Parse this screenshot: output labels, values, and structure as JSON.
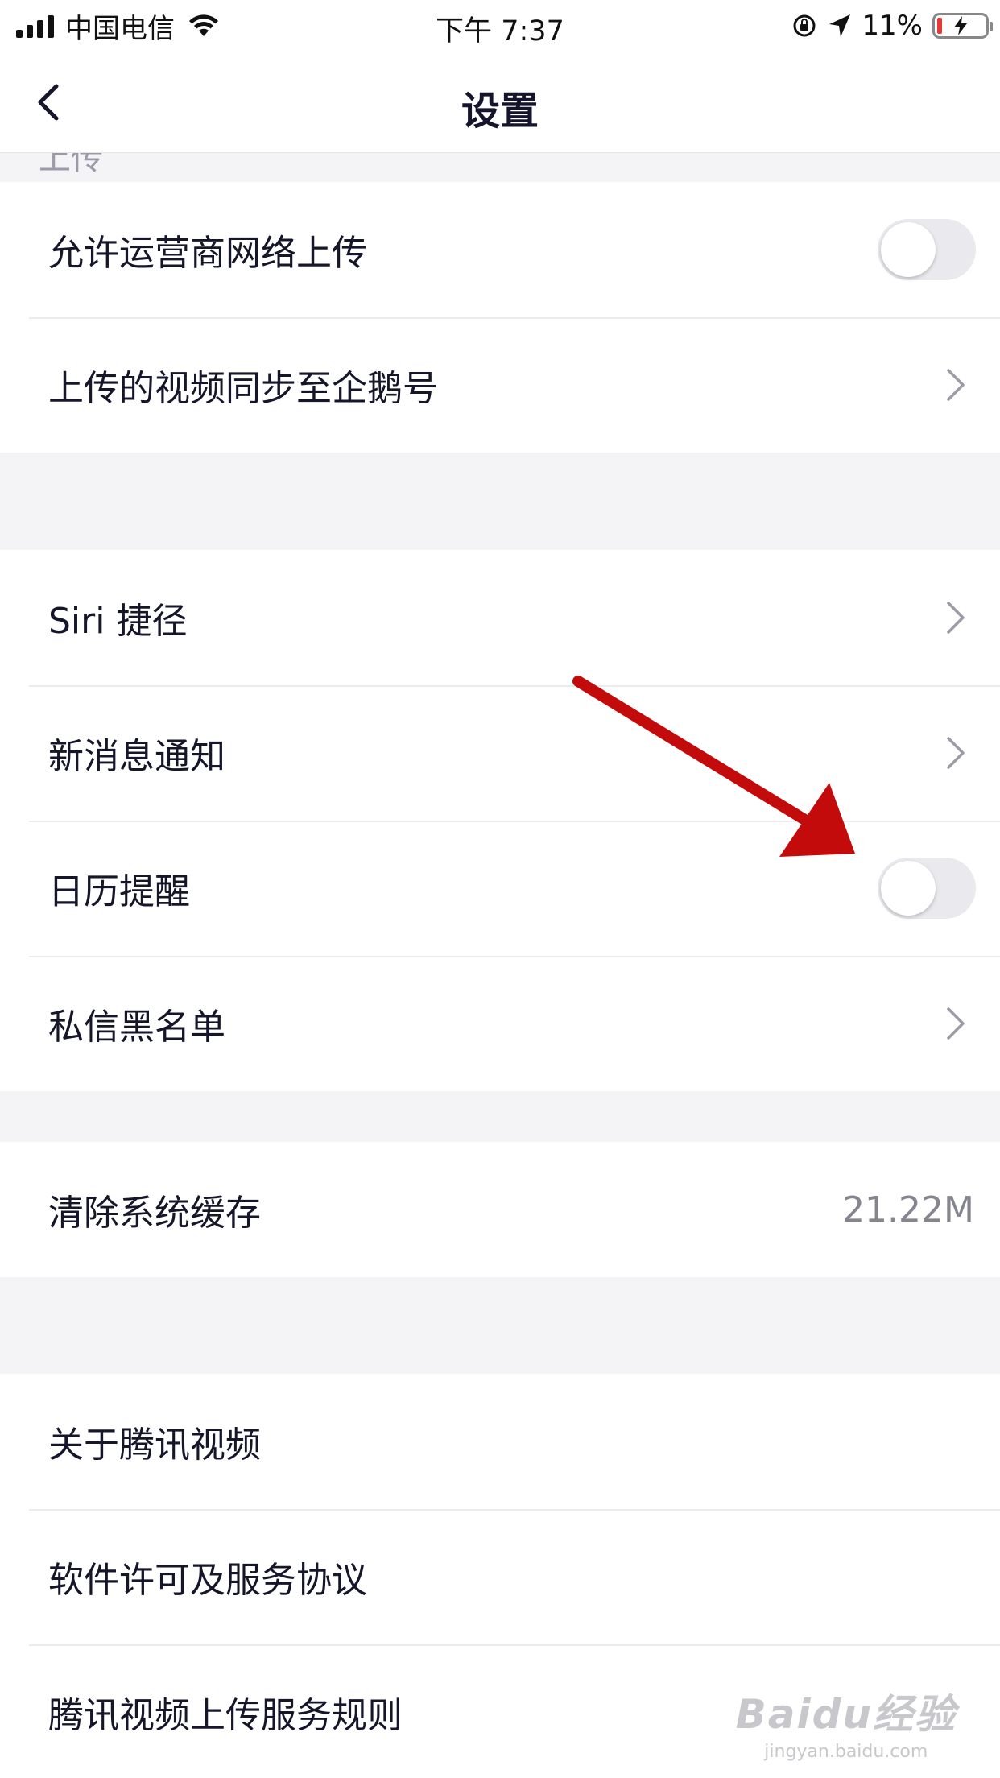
{
  "status_bar": {
    "carrier": "中国电信",
    "time": "下午 7:37",
    "battery": "11%",
    "signal_icon": "signal-bars-icon",
    "wifi_icon": "wifi-icon",
    "rotation_lock_icon": "rotation-lock-icon",
    "location_icon": "location-arrow-icon",
    "battery_icon": "battery-charging-icon"
  },
  "nav": {
    "title": "设置",
    "back_icon": "chevron-left-icon"
  },
  "section_hint": "上传",
  "groups": {
    "upload": {
      "items": [
        {
          "label": "允许运营商网络上传",
          "control": "toggle",
          "on": false
        },
        {
          "label": "上传的视频同步至企鹅号",
          "control": "chevron"
        }
      ]
    },
    "general": {
      "items": [
        {
          "label": "Siri 捷径",
          "control": "chevron"
        },
        {
          "label": "新消息通知",
          "control": "chevron"
        },
        {
          "label": "日历提醒",
          "control": "toggle",
          "on": false
        },
        {
          "label": "私信黑名单",
          "control": "chevron"
        }
      ]
    },
    "cache": {
      "items": [
        {
          "label": "清除系统缓存",
          "value": "21.22M"
        }
      ]
    },
    "about": {
      "items": [
        {
          "label": "关于腾讯视频"
        },
        {
          "label": "软件许可及服务协议"
        },
        {
          "label": "腾讯视频上传服务规则"
        }
      ]
    }
  },
  "annotation": {
    "color": "#c30b0b"
  },
  "watermark": {
    "logo": "Baidu经验",
    "url": "jingyan.baidu.com"
  },
  "colors": {
    "background": "#f4f4f7",
    "card": "#ffffff",
    "text": "#16162b",
    "toggle_off": "#e9e9ee"
  }
}
